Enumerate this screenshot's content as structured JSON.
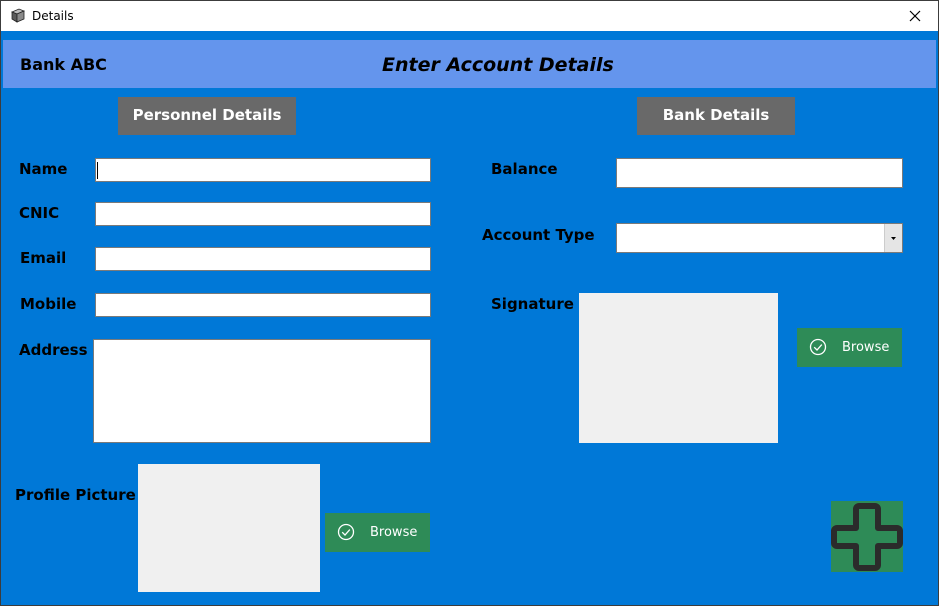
{
  "window": {
    "title": "Details",
    "icon": "app-icon",
    "close_icon": "close-icon"
  },
  "header": {
    "bank_name": "Bank ABC",
    "form_title": "Enter Account Details"
  },
  "personal": {
    "section_label": "Personnel Details",
    "fields": {
      "name": {
        "label": "Name",
        "value": ""
      },
      "cnic": {
        "label": "CNIC",
        "value": ""
      },
      "email": {
        "label": "Email",
        "value": ""
      },
      "mobile": {
        "label": "Mobile",
        "value": ""
      },
      "address": {
        "label": "Address",
        "value": ""
      }
    },
    "profile_picture": {
      "label": "Profile Picture",
      "browse_label": "Browse",
      "browse_icon": "check-circle-icon"
    }
  },
  "bank": {
    "section_label": "Bank Details",
    "balance": {
      "label": "Balance",
      "value": ""
    },
    "account_type": {
      "label": "Account Type",
      "selected": ""
    },
    "signature": {
      "label": "Signature",
      "browse_label": "Browse",
      "browse_icon": "check-circle-icon"
    }
  },
  "actions": {
    "add_icon": "plus-icon"
  },
  "colors": {
    "window_background": "#0078d7",
    "header_background": "#6495ed",
    "section_button": "#696969",
    "browse_button": "#2e8b57",
    "add_button": "#2e8b57",
    "picture_placeholder": "#f0f0f0"
  }
}
